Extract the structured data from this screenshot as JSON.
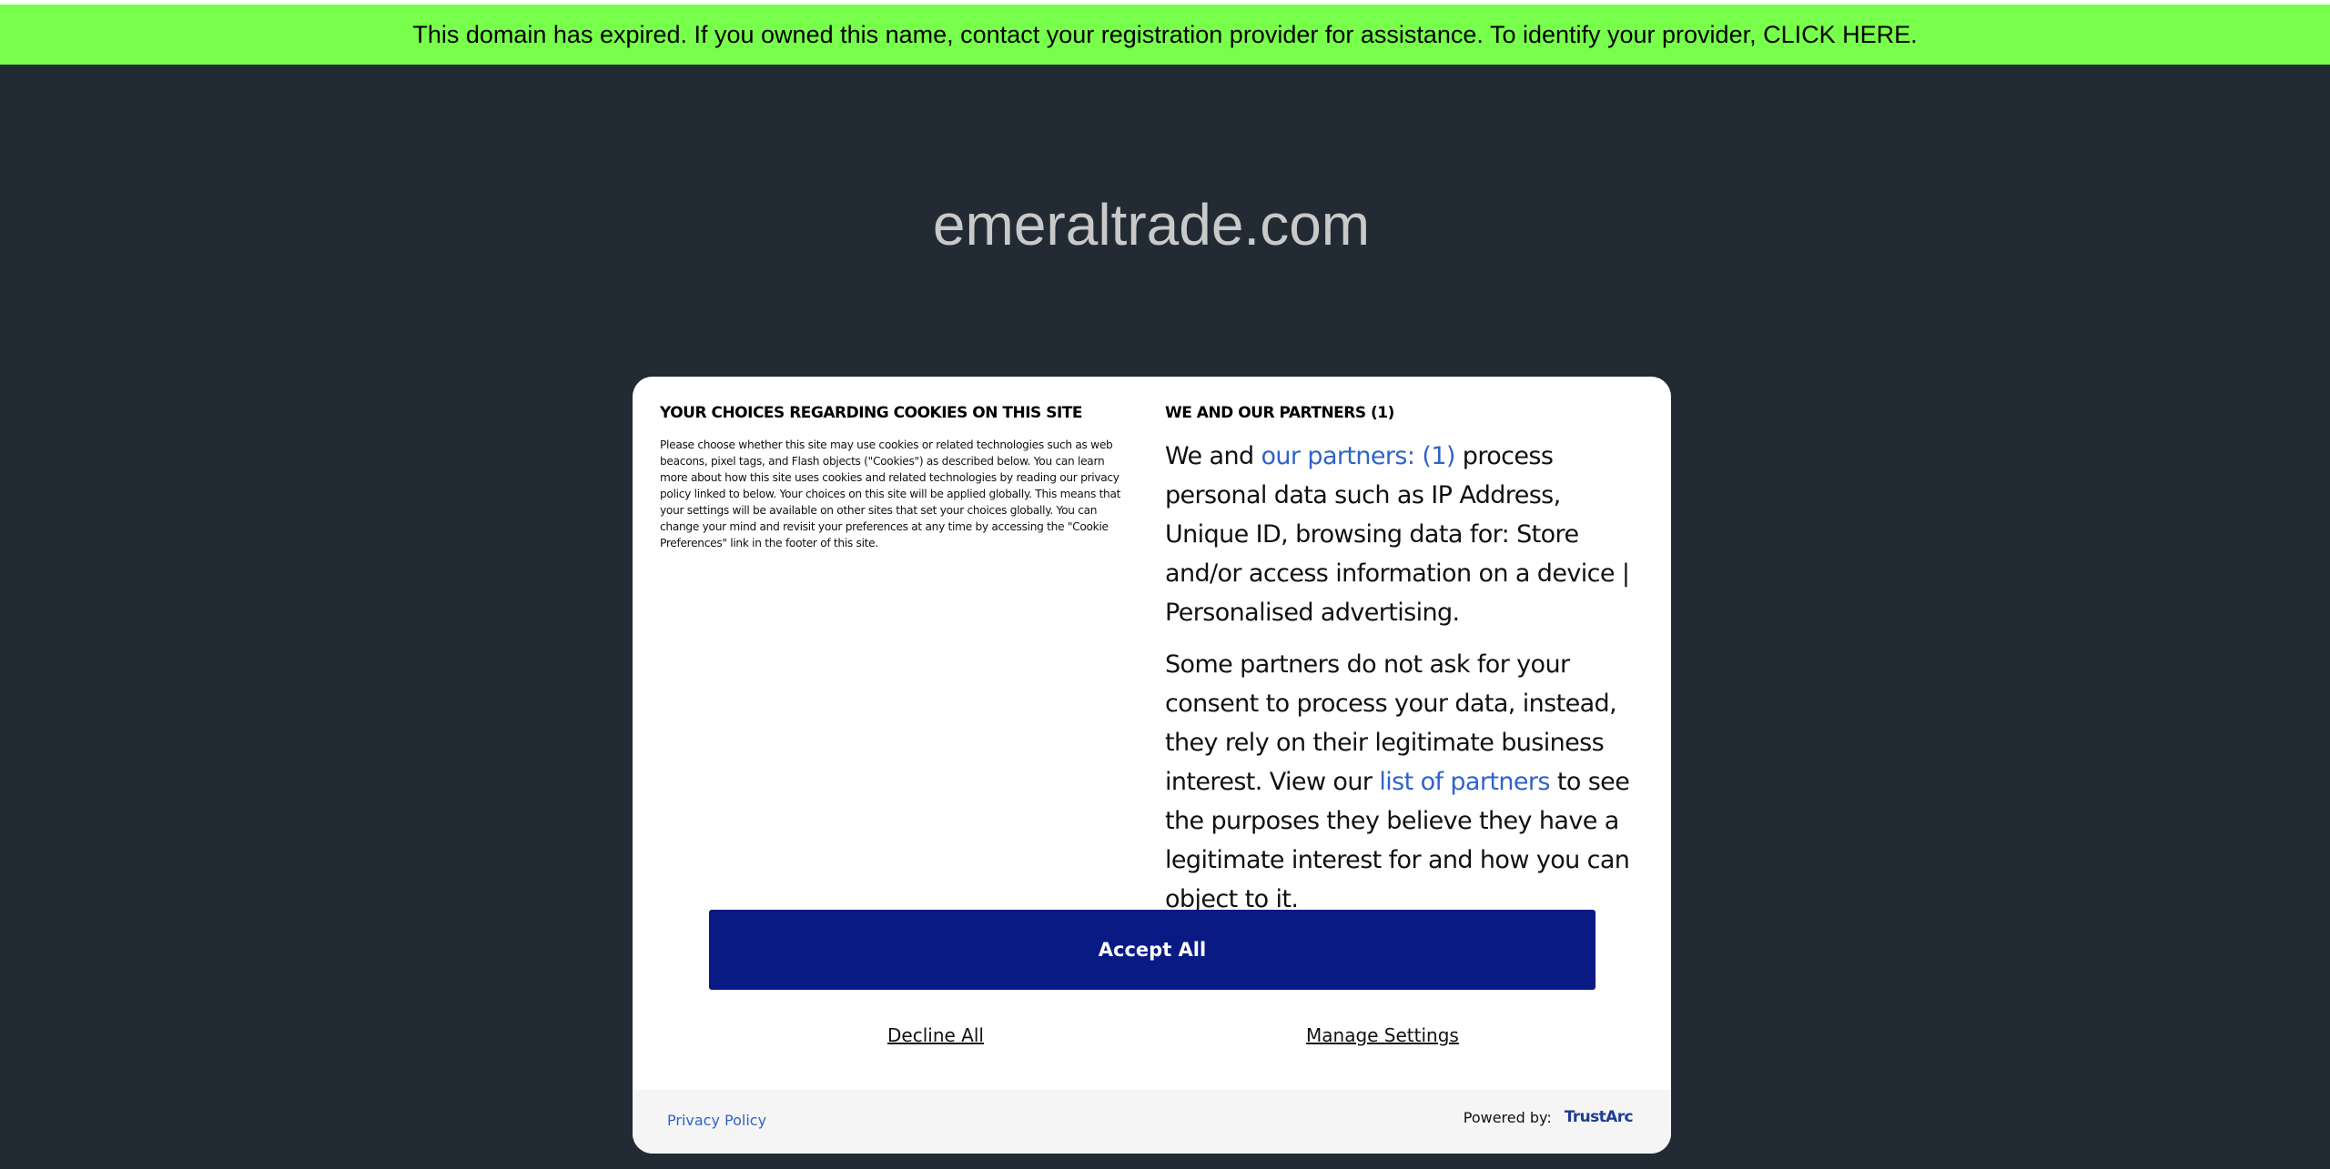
{
  "banner": {
    "text": "This domain has expired. If you owned this name, contact your registration provider for assistance. To identify your provider, CLICK HERE.",
    "color": "#77ff4b"
  },
  "domain": "emeraltrade.com",
  "dialog": {
    "left": {
      "heading": "YOUR CHOICES REGARDING COOKIES ON THIS SITE",
      "text": "Please choose whether this site may use cookies or related technologies such as web beacons, pixel tags, and Flash objects (\"Cookies\") as described below. You can learn more about how this site uses cookies and related technologies by reading our privacy policy linked to below. Your choices on this site will be applied globally. This means that your settings will be available on other sites that set your choices globally. You can change your mind and revisit your preferences at any time by accessing the \"Cookie Preferences\" link in the footer of this site."
    },
    "right": {
      "heading": "WE AND OUR PARTNERS (1)",
      "p1_before": "We and ",
      "p1_link": "our partners: (1)",
      "p1_after": " process personal data such as IP Address, Unique ID, browsing data for: Store and/or access information on a device | Personalised advertising.",
      "p2_before": "Some partners do not ask for your consent to process your data, instead, they rely on their legitimate business interest. View our ",
      "p2_link": "list of partners",
      "p2_after": " to see the purposes they believe they have a legitimate interest for and how you can object to it."
    },
    "accept_label": "Accept All",
    "decline_label": "Decline All",
    "manage_label": "Manage Settings",
    "footer": {
      "privacy_label": "Privacy Policy",
      "powered_label": "Powered by:",
      "brand": "TrustArc"
    },
    "colors": {
      "accept": "#0a1a85",
      "link": "#2f63c9",
      "background": "#222b34"
    }
  }
}
